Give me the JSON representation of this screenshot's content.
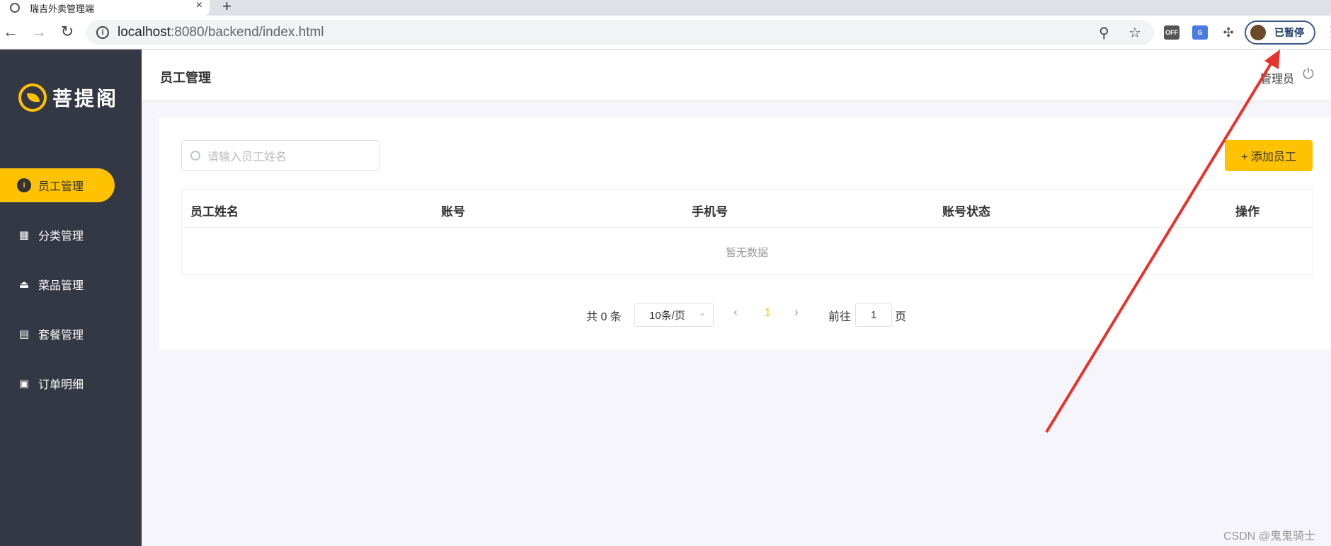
{
  "browser": {
    "tab_title": "瑞吉外卖管理端",
    "tab_close": "×",
    "new_tab": "+",
    "url_host": "localhost",
    "url_rest": ":8080/backend/index.html",
    "ext_off_label": "OFF",
    "profile_label": "已暂停",
    "back": "←",
    "forward": "→",
    "reload": "↻",
    "info": "i"
  },
  "sidebar": {
    "logo_text": "菩提阁",
    "items": [
      {
        "label": "员工管理",
        "icon": "user-icon",
        "glyph": "i",
        "active": true
      },
      {
        "label": "分类管理",
        "icon": "grid-icon",
        "glyph": "▦"
      },
      {
        "label": "菜品管理",
        "icon": "dish-icon",
        "glyph": "⏏"
      },
      {
        "label": "套餐管理",
        "icon": "gift-icon",
        "glyph": "▤"
      },
      {
        "label": "订单明细",
        "icon": "clipboard-icon",
        "glyph": "▣"
      }
    ]
  },
  "header": {
    "title": "员工管理",
    "admin_label": "管理员",
    "power_glyph": "⏻"
  },
  "main": {
    "search_placeholder": "请输入员工姓名",
    "add_button": "+ 添加员工",
    "columns": [
      "员工姓名",
      "账号",
      "手机号",
      "账号状态",
      "操作"
    ],
    "empty_text": "暂无数据"
  },
  "pagination": {
    "total_text": "共 0 条",
    "page_size": "10条/页",
    "prev": "‹",
    "current_page": "1",
    "next": "›",
    "goto_label": "前往",
    "goto_value": "1",
    "page_suffix": "页"
  },
  "colors": {
    "accent": "#ffc200",
    "sidebar_bg": "#343744",
    "arrow": "#e8322c"
  },
  "watermark": "CSDN @鬼鬼骑士"
}
